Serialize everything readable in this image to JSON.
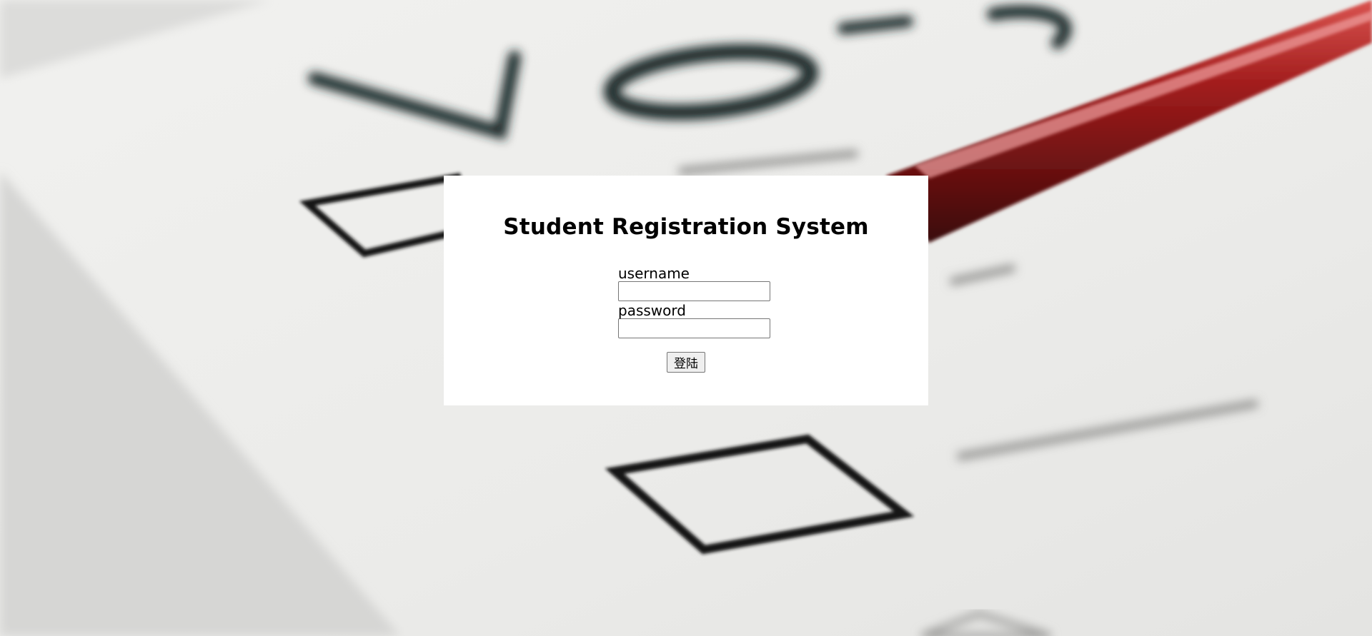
{
  "background": {
    "lettering": "Vote"
  },
  "login": {
    "title": "Student Registration System",
    "username_label": "username",
    "username_value": "",
    "password_label": "password",
    "password_value": "",
    "submit_label": "登陆"
  },
  "colors": {
    "card_background": "#ffffff",
    "page_background": "#e9e9e7",
    "pencil_red": "#9e1b1b"
  }
}
